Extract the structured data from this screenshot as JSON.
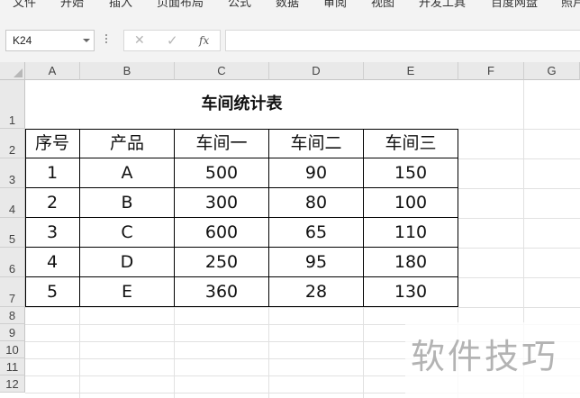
{
  "ribbon": {
    "tabs": [
      "文件",
      "开始",
      "插入",
      "页面布局",
      "公式",
      "数据",
      "审阅",
      "视图",
      "开发工具",
      "百度网盘",
      "照片"
    ]
  },
  "formula_bar": {
    "name_box": "K24",
    "cancel_icon": "✕",
    "enter_icon": "✓",
    "fx_label": "fx",
    "formula": ""
  },
  "sheet": {
    "columns": [
      "A",
      "B",
      "C",
      "D",
      "E",
      "F",
      "G"
    ],
    "rows": [
      "1",
      "2",
      "3",
      "4",
      "5",
      "6",
      "7",
      "8",
      "9",
      "10",
      "11",
      "12"
    ]
  },
  "table": {
    "title": "车间统计表",
    "headers": [
      "序号",
      "产品",
      "车间一",
      "车间二",
      "车间三"
    ],
    "rows": [
      [
        "1",
        "A",
        "500",
        "90",
        "150"
      ],
      [
        "2",
        "B",
        "300",
        "80",
        "100"
      ],
      [
        "3",
        "C",
        "600",
        "65",
        "110"
      ],
      [
        "4",
        "D",
        "250",
        "95",
        "180"
      ],
      [
        "5",
        "E",
        "360",
        "28",
        "130"
      ]
    ]
  },
  "watermark": "软件技巧",
  "colors": {
    "grid": "#e1e1e1",
    "header_bg": "#e9e9e9",
    "ribbon_bg": "#f3f3f3"
  }
}
